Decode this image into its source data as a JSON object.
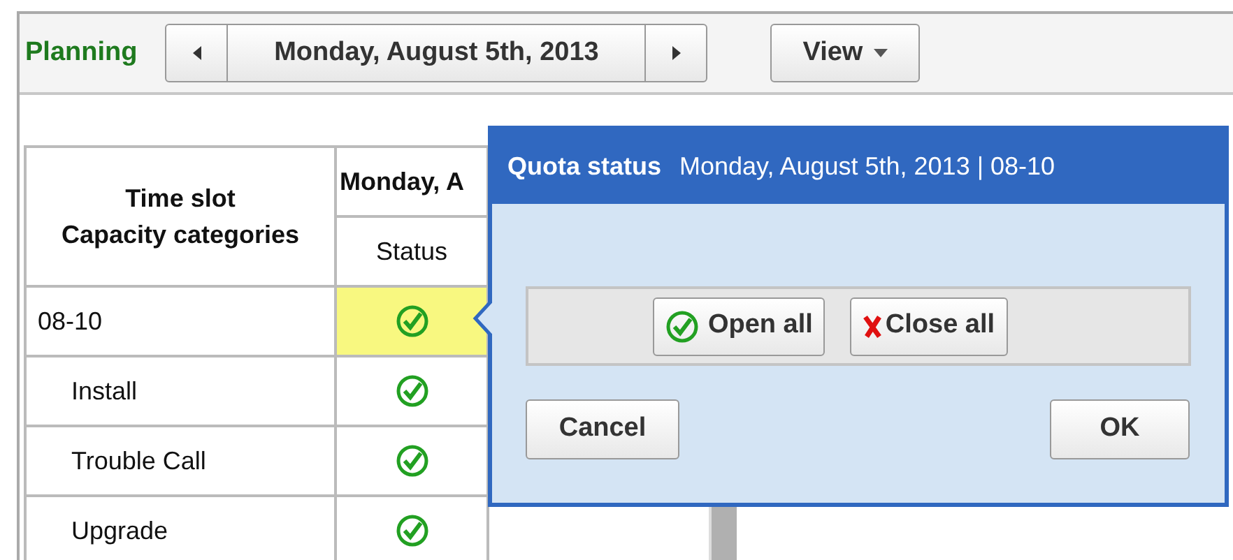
{
  "toolbar": {
    "title": "Planning",
    "date": "Monday, August 5th, 2013",
    "view_button": "View"
  },
  "table": {
    "columns": [
      "Time slot\nCapacity categories",
      "Monday, A"
    ],
    "subheader": "Status",
    "rows": [
      {
        "label": "08-10",
        "open": true,
        "selected": true,
        "children": [
          {
            "label": "Install",
            "open": true,
            "selected": false
          },
          {
            "label": "Trouble Call",
            "open": true,
            "selected": false
          },
          {
            "label": "Upgrade",
            "open": true,
            "selected": false
          }
        ]
      }
    ]
  },
  "popup": {
    "title": "Quota status",
    "subtitle": "Monday, August 5th, 2013 | 08-10",
    "open_all": "Open all",
    "close_all": "Close all",
    "cancel": "Cancel",
    "ok": "OK"
  }
}
